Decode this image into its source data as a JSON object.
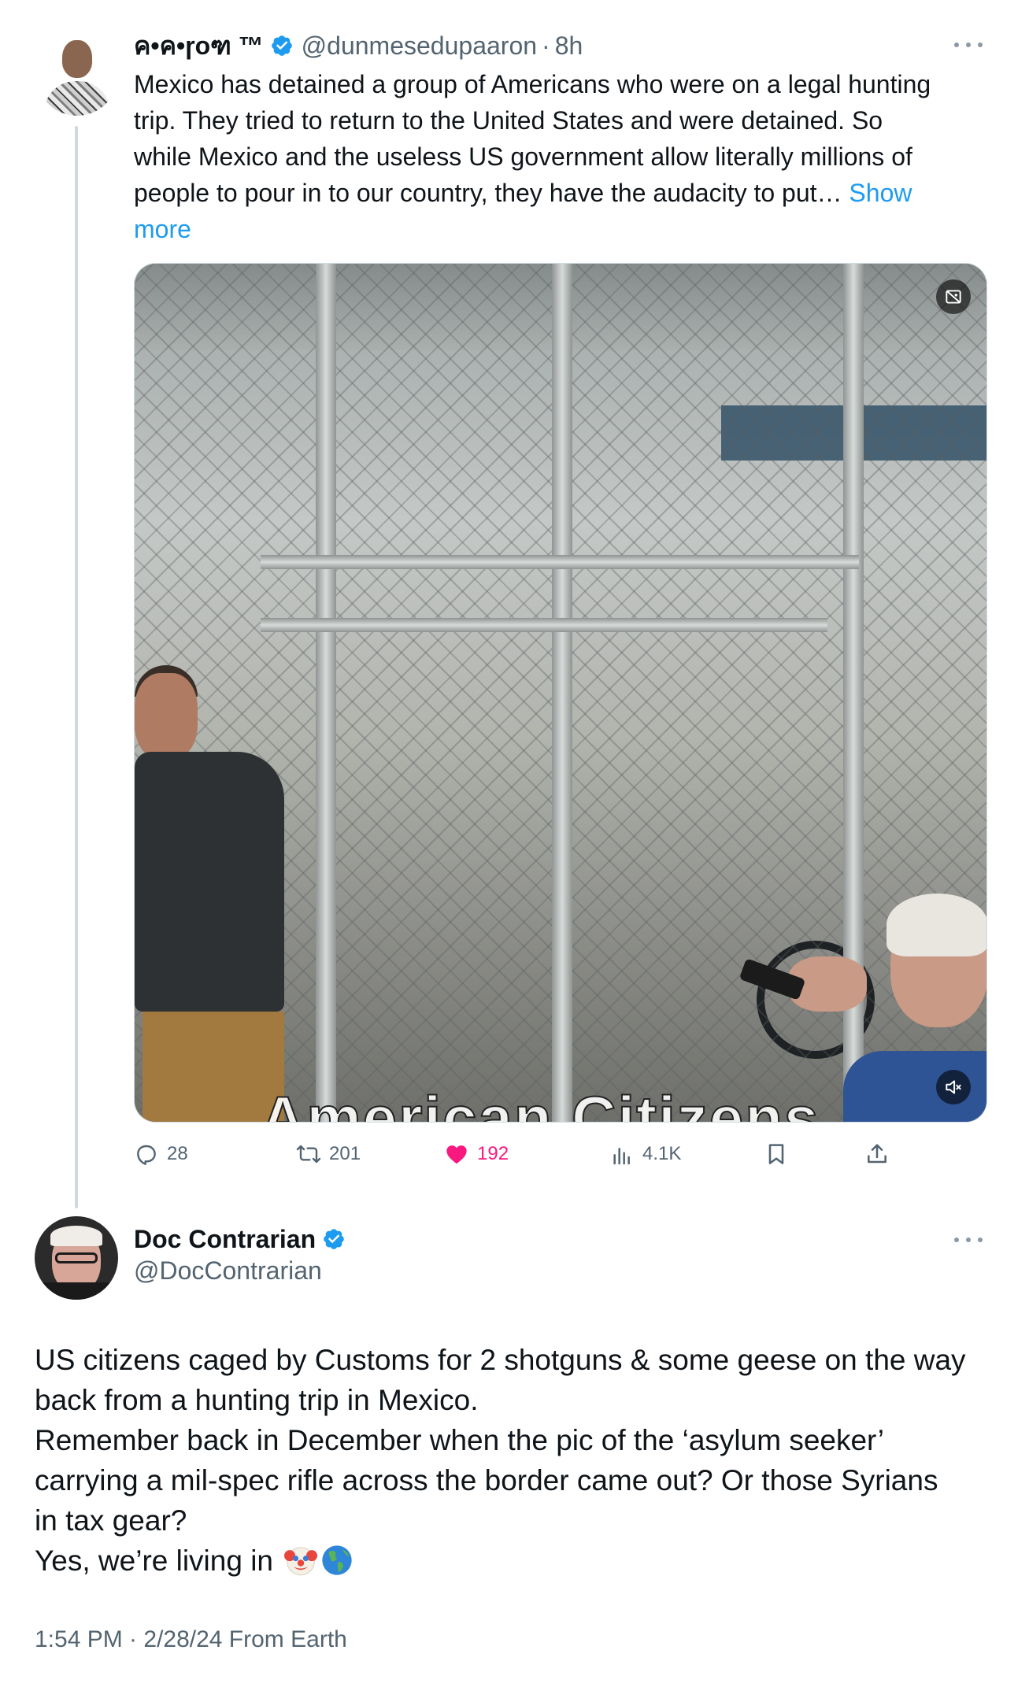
{
  "tweet1": {
    "display_name": "ค•ค•ɼoฑ ™",
    "handle": "@dunmesedupaaron",
    "separator": "·",
    "time": "8h",
    "text_lines": [
      "Mexico has detained a group of Americans who were on a legal hunting",
      "trip. They tried to return to the United States and were detained. So",
      "while Mexico and the useless US government allow literally millions of",
      "people to pour in to our country, they have the audacity to put… "
    ],
    "show_more_first": "Show",
    "show_more_second": "more",
    "media": {
      "overlay_caption": "American Citizens",
      "badge_icon": "content-warning-icon",
      "mute_icon": "muted-speaker-icon"
    },
    "actions": {
      "replies": "28",
      "reposts": "201",
      "likes": "192",
      "views": "4.1K"
    },
    "colors": {
      "like": "#f91880",
      "link": "#1d9bf0",
      "secondary_text": "#536471",
      "verified": "#1d9bf0"
    }
  },
  "tweet2": {
    "display_name": "Doc Contrarian",
    "handle": "@DocContrarian",
    "text_lines": [
      "US citizens caged by Customs for 2 shotguns & some geese on the way",
      "back from a hunting trip in Mexico.",
      "Remember back in December when the pic of the ‘asylum seeker’",
      "carrying a mil-spec rifle across the border came out? Or those Syrians",
      "in tax gear?",
      "Yes, we’re living in "
    ],
    "emojis": [
      "clown-face-icon",
      "globe-americas-icon"
    ],
    "meta": "1:54 PM · 2/28/24 From Earth"
  }
}
